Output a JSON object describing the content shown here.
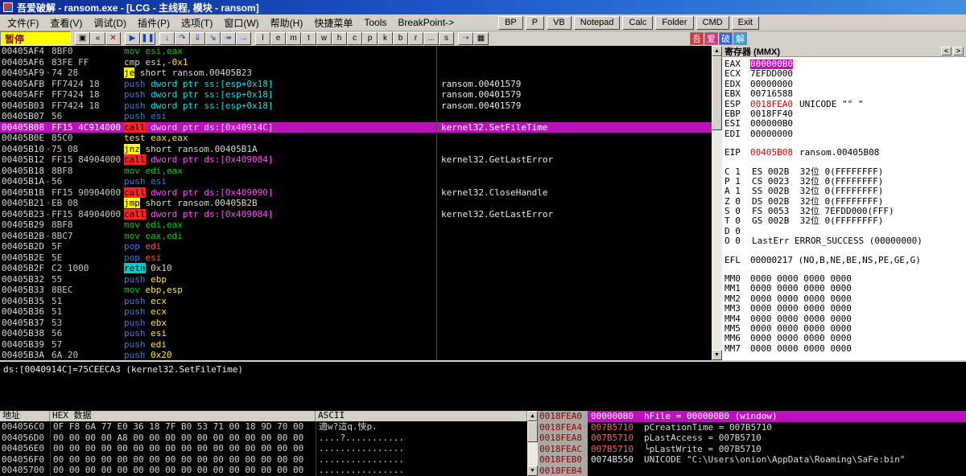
{
  "titlebar": {
    "title": "吾爱破解 - ransom.exe - [LCG - 主线程, 模块 - ransom]"
  },
  "icons": {
    "up_arrow": "▲",
    "down_arrow": "▼",
    "nav_left": "<",
    "nav_right": ">"
  },
  "menu_bar": {
    "menus": [
      "文件(F)",
      "查看(V)",
      "调试(D)",
      "插件(P)",
      "选项(T)",
      "窗口(W)",
      "帮助(H)",
      "快捷菜单",
      "Tools",
      "BreakPoint->"
    ],
    "quick_buttons": [
      "BP",
      "P",
      "VB",
      "Notepad",
      "Calc",
      "Folder",
      "CMD",
      "Exit"
    ]
  },
  "toolbar": {
    "status_label": "暂停",
    "groups": [
      {
        "name": "file",
        "buttons": [
          {
            "icon": "open-icon",
            "glyph": "▣",
            "cls": "dark"
          },
          {
            "icon": "restart-icon",
            "glyph": "«",
            "cls": "dark"
          },
          {
            "icon": "close-icon",
            "glyph": "✕",
            "cls": "red"
          }
        ]
      },
      {
        "name": "run",
        "buttons": [
          {
            "icon": "run-icon",
            "glyph": "▶"
          },
          {
            "icon": "pause-icon",
            "glyph": "❚❚"
          }
        ]
      },
      {
        "name": "step",
        "buttons": [
          {
            "icon": "step-into-icon",
            "glyph": "↓"
          },
          {
            "icon": "step-over-icon",
            "glyph": "↷"
          },
          {
            "icon": "animate-into-icon",
            "glyph": "⇓"
          },
          {
            "icon": "animate-over-icon",
            "glyph": "⇘"
          },
          {
            "icon": "run-to-return-icon",
            "glyph": "↠"
          },
          {
            "icon": "goto-icon",
            "glyph": "→"
          }
        ]
      },
      {
        "name": "panes",
        "buttons": [
          {
            "icon": "log-icon",
            "glyph": "l",
            "cls": "dark"
          },
          {
            "icon": "executables-icon",
            "glyph": "e",
            "cls": "dark"
          },
          {
            "icon": "memory-icon",
            "glyph": "m",
            "cls": "dark"
          },
          {
            "icon": "threads-icon",
            "glyph": "t",
            "cls": "dark"
          },
          {
            "icon": "windows-icon",
            "glyph": "w",
            "cls": "dark"
          },
          {
            "icon": "handles-icon",
            "glyph": "h",
            "cls": "dark"
          },
          {
            "icon": "cpu-icon",
            "glyph": "c",
            "cls": "dark"
          },
          {
            "icon": "patches-icon",
            "glyph": "p",
            "cls": "dark"
          },
          {
            "icon": "callstack-icon",
            "glyph": "k",
            "cls": "dark"
          },
          {
            "icon": "breakpoints-icon",
            "glyph": "b",
            "cls": "dark"
          },
          {
            "icon": "references-icon",
            "glyph": "r",
            "cls": "dark"
          },
          {
            "icon": "runtrace-icon",
            "glyph": "...",
            "cls": "dark"
          },
          {
            "icon": "source-icon",
            "glyph": "s",
            "cls": "dark"
          }
        ]
      },
      {
        "name": "extra",
        "buttons": [
          {
            "icon": "trace-icon",
            "glyph": "⇢"
          },
          {
            "icon": "options-icon",
            "glyph": "▦",
            "cls": "dark"
          }
        ]
      }
    ],
    "logo_blocks": [
      {
        "ch": "吾",
        "bg": "#d43434"
      },
      {
        "ch": "爱",
        "bg": "#d4347e"
      },
      {
        "ch": "破",
        "bg": "#3460d4"
      },
      {
        "ch": "解",
        "bg": "#34a0d4"
      }
    ]
  },
  "disasm": {
    "rows": [
      {
        "addr": "00405AF4",
        "bytes": "8BF0",
        "asm": [
          {
            "t": "mov esi,eax",
            "c": "g"
          }
        ]
      },
      {
        "addr": "00405AF6",
        "bytes": "83FE FF",
        "asm": [
          {
            "t": "cmp esi,",
            "c": "w"
          },
          {
            "t": "-0x1",
            "c": "y"
          }
        ]
      },
      {
        "addr": "00405AF9",
        "bytes": "74 28",
        "mark": "▾",
        "asm": [
          {
            "t": "je",
            "c": "jy"
          },
          {
            "t": " short ransom.00405B23",
            "c": "w"
          }
        ]
      },
      {
        "addr": "00405AFB",
        "bytes": "FF7424 18",
        "asm": [
          {
            "t": "push",
            "c": "b"
          },
          {
            "t": " dword ptr ss:[esp+0x18]",
            "c": "c"
          }
        ],
        "comment": "ransom.00401579"
      },
      {
        "addr": "00405AFF",
        "bytes": "FF7424 18",
        "asm": [
          {
            "t": "push",
            "c": "b"
          },
          {
            "t": " dword ptr ss:[esp+0x18]",
            "c": "c"
          }
        ],
        "comment": "ransom.00401579"
      },
      {
        "addr": "00405B03",
        "bytes": "FF7424 18",
        "asm": [
          {
            "t": "push",
            "c": "b"
          },
          {
            "t": " dword ptr ss:[esp+0x18]",
            "c": "c"
          }
        ],
        "comment": "ransom.00401579"
      },
      {
        "addr": "00405B07",
        "bytes": "56",
        "asm": [
          {
            "t": "push esi",
            "c": "b"
          }
        ]
      },
      {
        "addr": "00405B08",
        "bytes": "FF15 4C914000",
        "sel": true,
        "asm": [
          {
            "t": "call",
            "c": "cb"
          },
          {
            "t": " dword ptr ds:[0x40914C]",
            "c": "m"
          }
        ],
        "comment": "kernel32.SetFileTime"
      },
      {
        "addr": "00405B0E",
        "bytes": "85C0",
        "asm": [
          {
            "t": "test eax,eax",
            "c": "y"
          }
        ]
      },
      {
        "addr": "00405B10",
        "bytes": "75 08",
        "mark": "▾",
        "asm": [
          {
            "t": "jnz",
            "c": "jy"
          },
          {
            "t": " short ransom.00405B1A",
            "c": "w"
          }
        ]
      },
      {
        "addr": "00405B12",
        "bytes": "FF15 84904000",
        "asm": [
          {
            "t": "call",
            "c": "cb"
          },
          {
            "t": " dword ptr ds:[0x409084]",
            "c": "m"
          }
        ],
        "comment": "kernel32.GetLastError"
      },
      {
        "addr": "00405B18",
        "bytes": "8BF8",
        "asm": [
          {
            "t": "mov edi,eax",
            "c": "g"
          }
        ]
      },
      {
        "addr": "00405B1A",
        "bytes": "56",
        "mark": "▸",
        "asm": [
          {
            "t": "push esi",
            "c": "b"
          }
        ]
      },
      {
        "addr": "00405B1B",
        "bytes": "FF15 90904000",
        "asm": [
          {
            "t": "call",
            "c": "cb"
          },
          {
            "t": " dword ptr ds:[0x409090]",
            "c": "m"
          }
        ],
        "comment": "kernel32.CloseHandle"
      },
      {
        "addr": "00405B21",
        "bytes": "EB 08",
        "mark": "▾",
        "asm": [
          {
            "t": "jmp",
            "c": "jy"
          },
          {
            "t": " short ransom.00405B2B",
            "c": "w"
          }
        ]
      },
      {
        "addr": "00405B23",
        "bytes": "FF15 84904000",
        "mark": "▸",
        "asm": [
          {
            "t": "call",
            "c": "cb"
          },
          {
            "t": " dword ptr ds:[0x409084]",
            "c": "m"
          }
        ],
        "comment": "kernel32.GetLastError"
      },
      {
        "addr": "00405B29",
        "bytes": "8BF8",
        "asm": [
          {
            "t": "mov edi,eax",
            "c": "g"
          }
        ]
      },
      {
        "addr": "00405B2B",
        "bytes": "8BC7",
        "mark": "▸",
        "asm": [
          {
            "t": "mov eax,edi",
            "c": "g"
          }
        ]
      },
      {
        "addr": "00405B2D",
        "bytes": "5F",
        "asm": [
          {
            "t": "pop",
            "c": "b"
          },
          {
            "t": " edi",
            "c": "r"
          }
        ]
      },
      {
        "addr": "00405B2E",
        "bytes": "5E",
        "asm": [
          {
            "t": "pop",
            "c": "b"
          },
          {
            "t": " esi",
            "c": "r"
          }
        ]
      },
      {
        "addr": "00405B2F",
        "bytes": "C2 1000",
        "asm": [
          {
            "t": "retn",
            "c": "tb"
          },
          {
            "t": " 0x10",
            "c": "w"
          }
        ]
      },
      {
        "addr": "00405B32",
        "bytes": "55",
        "asm": [
          {
            "t": "push",
            "c": "b"
          },
          {
            "t": " ebp",
            "c": "y"
          }
        ]
      },
      {
        "addr": "00405B33",
        "bytes": "8BEC",
        "asm": [
          {
            "t": "mov",
            "c": "g"
          },
          {
            "t": " ebp,esp",
            "c": "y"
          }
        ]
      },
      {
        "addr": "00405B35",
        "bytes": "51",
        "asm": [
          {
            "t": "push",
            "c": "b"
          },
          {
            "t": " ecx",
            "c": "y"
          }
        ]
      },
      {
        "addr": "00405B36",
        "bytes": "51",
        "asm": [
          {
            "t": "push",
            "c": "b"
          },
          {
            "t": " ecx",
            "c": "y"
          }
        ]
      },
      {
        "addr": "00405B37",
        "bytes": "53",
        "asm": [
          {
            "t": "push",
            "c": "b"
          },
          {
            "t": " ebx",
            "c": "y"
          }
        ]
      },
      {
        "addr": "00405B38",
        "bytes": "56",
        "asm": [
          {
            "t": "push",
            "c": "b"
          },
          {
            "t": " esi",
            "c": "y"
          }
        ]
      },
      {
        "addr": "00405B39",
        "bytes": "57",
        "asm": [
          {
            "t": "push",
            "c": "b"
          },
          {
            "t": " edi",
            "c": "y"
          }
        ]
      },
      {
        "addr": "00405B3A",
        "bytes": "6A 20",
        "asm": [
          {
            "t": "push",
            "c": "b"
          },
          {
            "t": " 0x20",
            "c": "y"
          }
        ]
      }
    ]
  },
  "info_pane": {
    "line1": "ds:[0040914C]=75CEECA3 (kernel32.SetFileTime)"
  },
  "registers": {
    "title": "寄存器 (MMX)",
    "gpr": [
      {
        "name": "EAX",
        "value": "000000B0",
        "style": "hl"
      },
      {
        "name": "ECX",
        "value": "7EFDD000"
      },
      {
        "name": "EDX",
        "value": "00000000"
      },
      {
        "name": "EBX",
        "value": "00716588"
      },
      {
        "name": "ESP",
        "value": "0018FEA0",
        "style": "red",
        "comment": "UNICODE \"° \""
      },
      {
        "name": "EBP",
        "value": "0018FF40"
      },
      {
        "name": "ESI",
        "value": "000000B0"
      },
      {
        "name": "EDI",
        "value": "00000000"
      }
    ],
    "eip": {
      "name": "EIP",
      "value": "00405B08",
      "style": "red",
      "comment": "ransom.00405B08"
    },
    "flags": [
      {
        "f": "C",
        "v": "1",
        "seg": "ES",
        "sv": "002B",
        "desc": "32位 0(FFFFFFFF)"
      },
      {
        "f": "P",
        "v": "1",
        "seg": "CS",
        "sv": "0023",
        "desc": "32位 0(FFFFFFFF)"
      },
      {
        "f": "A",
        "v": "1",
        "seg": "SS",
        "sv": "002B",
        "desc": "32位 0(FFFFFFFF)"
      },
      {
        "f": "Z",
        "v": "0",
        "seg": "DS",
        "sv": "002B",
        "desc": "32位 0(FFFFFFFF)"
      },
      {
        "f": "S",
        "v": "0",
        "seg": "FS",
        "sv": "0053",
        "desc": "32位 7EFDD000(FFF)"
      },
      {
        "f": "T",
        "v": "0",
        "seg": "GS",
        "sv": "002B",
        "desc": "32位 0(FFFFFFFF)"
      },
      {
        "f": "D",
        "v": "0",
        "seg": "",
        "sv": "",
        "desc": ""
      },
      {
        "f": "O",
        "v": "0",
        "seg": "",
        "sv": "",
        "desc": "LastErr ERROR_SUCCESS (00000000)"
      }
    ],
    "efl": {
      "name": "EFL",
      "value": "00000217",
      "desc": "(NO,B,NE,BE,NS,PE,GE,G)"
    },
    "mmx": [
      {
        "name": "MM0",
        "value": "0000 0000 0000 0000"
      },
      {
        "name": "MM1",
        "value": "0000 0000 0000 0000"
      },
      {
        "name": "MM2",
        "value": "0000 0000 0000 0000"
      },
      {
        "name": "MM3",
        "value": "0000 0000 0000 0000"
      },
      {
        "name": "MM4",
        "value": "0000 0000 0000 0000"
      },
      {
        "name": "MM5",
        "value": "0000 0000 0000 0000"
      },
      {
        "name": "MM6",
        "value": "0000 0000 0000 0000"
      },
      {
        "name": "MM7",
        "value": "0000 0000 0000 0000"
      }
    ]
  },
  "dump": {
    "headers": [
      "地址",
      "HEX 数据",
      "ASCII"
    ],
    "rows": [
      {
        "addr": "004056C0",
        "hex": "0F F8 6A 77 E0 36 18 7F B0 53 71 00 18 9D 70 00",
        "ascii": "適w?這q.悏p."
      },
      {
        "addr": "004056D0",
        "hex": "00 00 00 00 A8 00 00 00 00 00 00 00 00 00 00 00",
        "ascii": "....?..........."
      },
      {
        "addr": "004056E0",
        "hex": "00 00 00 00 00 00 00 00 00 00 00 00 00 00 00 00",
        "ascii": "................"
      },
      {
        "addr": "004056F0",
        "hex": "00 00 00 00 00 00 00 00 00 00 00 00 00 00 00 00",
        "ascii": "................"
      },
      {
        "addr": "00405700",
        "hex": "00 00 00 00 00 00 00 00 00 00 00 00 00 00 00 00",
        "ascii": "................"
      }
    ]
  },
  "stack": {
    "rows": [
      {
        "addr": "0018FEA0",
        "value": "000000B0",
        "comment": "hFile = 000000B0 (window)",
        "selected": true
      },
      {
        "addr": "0018FEA4",
        "value": "007B5710",
        "comment": "pCreationTime = 007B5710",
        "red": true
      },
      {
        "addr": "0018FEA8",
        "value": "007B5710",
        "comment": "pLastAccess = 007B5710",
        "red": true
      },
      {
        "addr": "0018FEAC",
        "value": "007B5710",
        "comment": "└pLastWrite = 007B5710",
        "red": true
      },
      {
        "addr": "0018FEB0",
        "value": "0074B550",
        "comment": "U"
      },
      {
        "addr": "0018FEB4",
        "value": "",
        "comment": ""
      }
    ],
    "unicode_comment": "UNICODE \"C:\\Users\\onion\\AppData\\Roaming\\SaFe:bin\""
  }
}
